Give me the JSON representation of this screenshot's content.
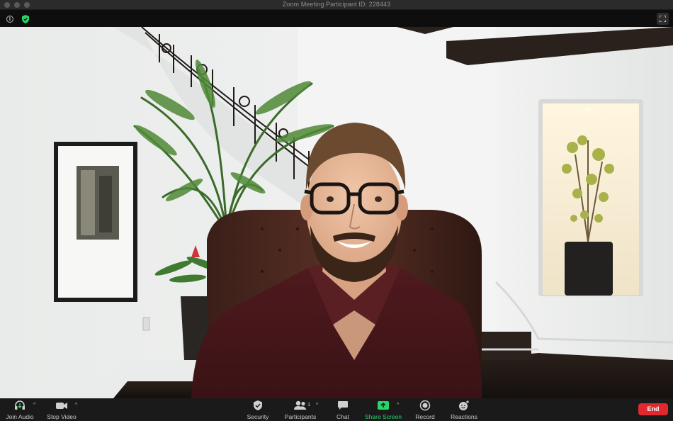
{
  "window": {
    "title": "Zoom Meeting Participant ID: 228443"
  },
  "participant": {
    "description": "participant-video-feed"
  },
  "toolbar": {
    "join_audio": "Join Audio",
    "stop_video": "Stop Video",
    "security": "Security",
    "participants": "Participants",
    "participants_count": "1",
    "chat": "Chat",
    "share_screen": "Share Screen",
    "record": "Record",
    "reactions": "Reactions",
    "end": "End"
  },
  "colors": {
    "share_green": "#2ad36b",
    "end_red": "#e0282e",
    "shield_green": "#2ad36b"
  },
  "icons": {
    "info": "i"
  }
}
